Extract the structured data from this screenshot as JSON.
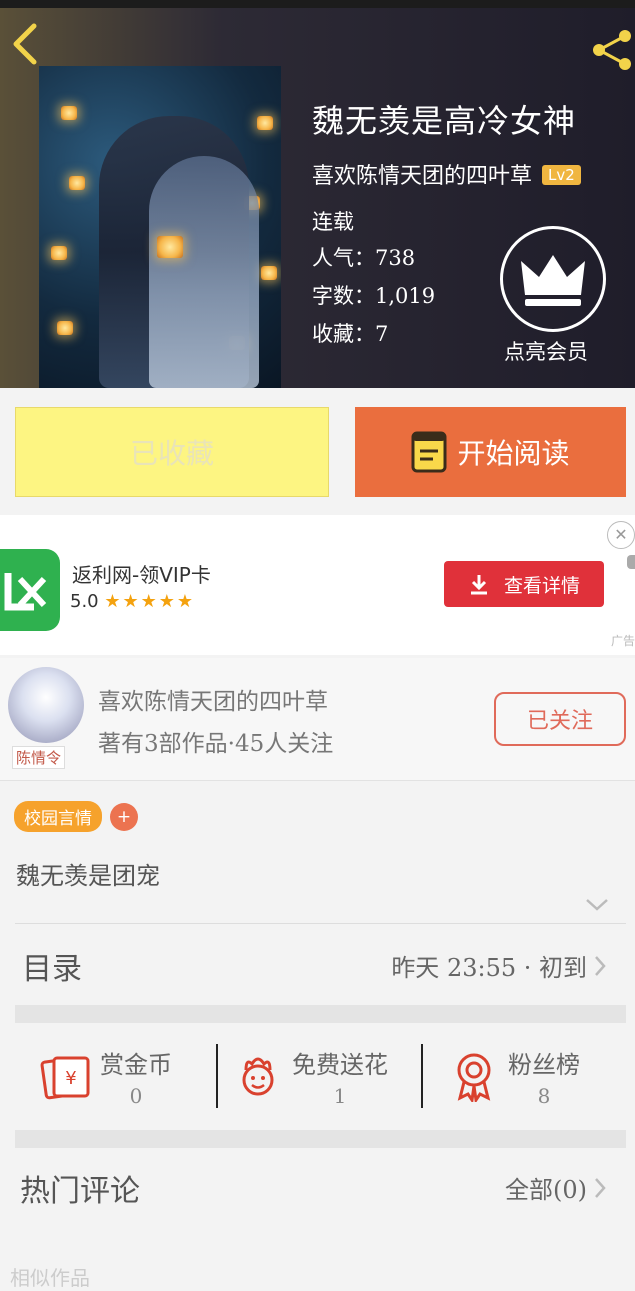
{
  "book": {
    "title": "魏无羡是高冷女神",
    "author": "喜欢陈情天团的四叶草",
    "level": "Lv2",
    "status": "连载",
    "popularity": "人气：738",
    "word_count": "字数：1,019",
    "favorites": "收藏：7",
    "vip_label": "点亮会员"
  },
  "buttons": {
    "collected": "已收藏",
    "start_reading": "开始阅读"
  },
  "ad": {
    "app_name": "返利网-领VIP卡",
    "rating": "5.0",
    "stars": "★★★★★",
    "cta": "查看详情",
    "close": "✕",
    "ad_tag": "广告"
  },
  "author_card": {
    "name": "喜欢陈情天团的四叶草",
    "meta": "著有3部作品·45人关注",
    "avatar_tag": "陈情令",
    "follow": "已关注"
  },
  "tags": {
    "genre": "校园言情",
    "add": "+"
  },
  "summary": "魏无羡是团宠",
  "toc": {
    "label": "目录",
    "update": "昨天 23:55 · 初到"
  },
  "actions": {
    "reward": {
      "label": "赏金币",
      "count": "0"
    },
    "flowers": {
      "label": "免费送花",
      "count": "1"
    },
    "fans": {
      "label": "粉丝榜",
      "count": "8"
    }
  },
  "comments": {
    "label": "热门评论",
    "all": "全部(0)"
  },
  "similar": "相似作品",
  "colors": {
    "accent_orange": "#ea6e3e",
    "collect_yellow": "#fdf582",
    "ad_red": "#e0313a",
    "tag_orange": "#f6a22c",
    "level_gold": "#f0b640"
  }
}
